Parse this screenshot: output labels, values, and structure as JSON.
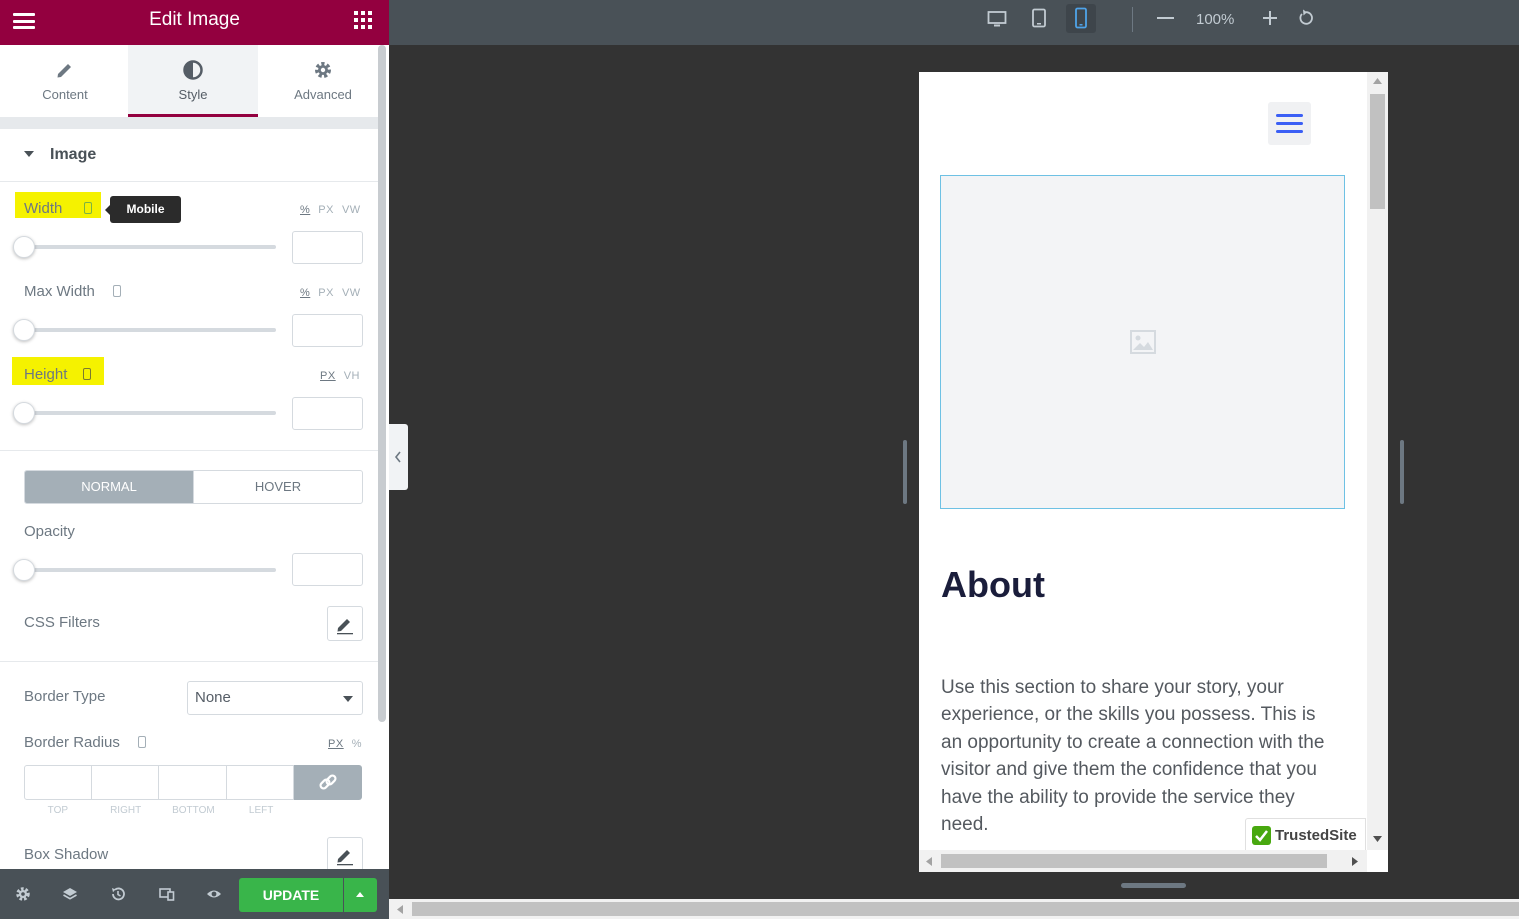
{
  "header": {
    "title": "Edit Image"
  },
  "tabs": [
    {
      "label": "Content",
      "icon": "pencil-icon"
    },
    {
      "label": "Style",
      "icon": "contrast-icon",
      "active": true
    },
    {
      "label": "Advanced",
      "icon": "gear-icon"
    }
  ],
  "section": {
    "title": "Image"
  },
  "tooltip": "Mobile",
  "controls": {
    "width": {
      "label": "Width",
      "units": [
        "%",
        "PX",
        "VW"
      ],
      "selected": "%",
      "value": ""
    },
    "max_width": {
      "label": "Max Width",
      "units": [
        "%",
        "PX",
        "VW"
      ],
      "selected": "%",
      "value": ""
    },
    "height": {
      "label": "Height",
      "units": [
        "PX",
        "VH"
      ],
      "selected": "PX",
      "value": ""
    },
    "state_tabs": [
      "NORMAL",
      "HOVER"
    ],
    "active_state": "NORMAL",
    "opacity": {
      "label": "Opacity",
      "value": ""
    },
    "css_filters": {
      "label": "CSS Filters"
    },
    "border_type": {
      "label": "Border Type",
      "value": "None"
    },
    "border_radius": {
      "label": "Border Radius",
      "units": [
        "PX",
        "%"
      ],
      "selected": "PX",
      "fields": [
        "TOP",
        "RIGHT",
        "BOTTOM",
        "LEFT"
      ]
    },
    "box_shadow": {
      "label": "Box Shadow"
    }
  },
  "footer": {
    "update_label": "UPDATE"
  },
  "topbar": {
    "zoom": "100%",
    "active_device": "mobile"
  },
  "preview": {
    "heading": "About",
    "paragraph": "Use this section to share your story, your experience, or the skills you possess. This is an opportunity to create a connection with the visitor and give them the confidence that you have the ability to provide the service they need.",
    "badge": "TrustedSite"
  },
  "colors": {
    "brand": "#93003f",
    "highlight": "#f5f200",
    "update": "#39b54a",
    "accent_blue": "#3b5ff5"
  }
}
